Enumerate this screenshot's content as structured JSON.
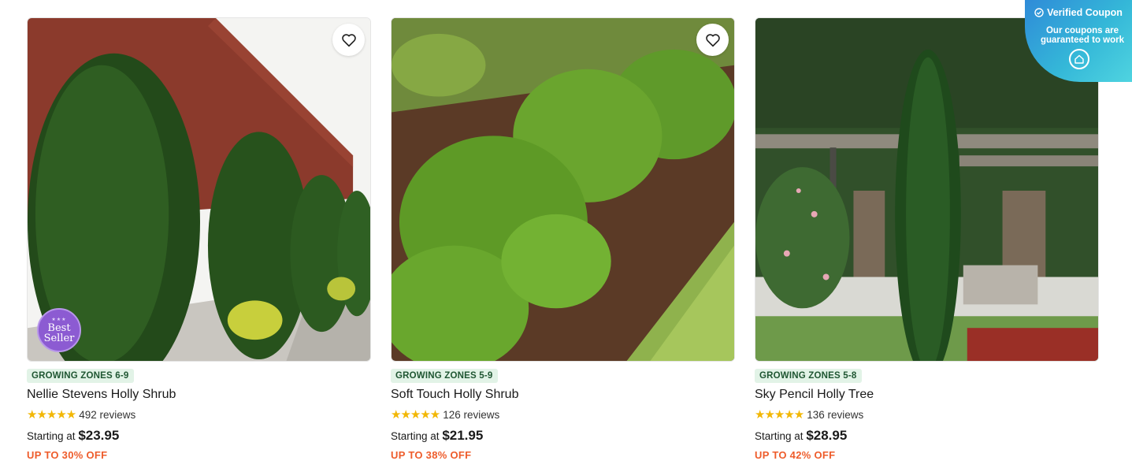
{
  "products": [
    {
      "zones": "GROWING ZONES 6-9",
      "name": "Nellie Stevens Holly Shrub",
      "rating_stars": "★★★★★",
      "reviews": "492 reviews",
      "price_prefix": "Starting at",
      "price": "$23.95",
      "discount": "UP TO 30% OFF",
      "badge_line1": "Best",
      "badge_line2": "Seller"
    },
    {
      "zones": "GROWING ZONES 5-9",
      "name": "Soft Touch Holly Shrub",
      "rating_stars": "★★★★★",
      "reviews": "126 reviews",
      "price_prefix": "Starting at",
      "price": "$21.95",
      "discount": "UP TO 38% OFF"
    },
    {
      "zones": "GROWING ZONES 5-8",
      "name": "Sky Pencil Holly Tree",
      "rating_stars": "★★★★★",
      "reviews": "136 reviews",
      "price_prefix": "Starting at",
      "price": "$28.95",
      "discount": "UP TO 42% OFF"
    }
  ],
  "coupon": {
    "title": "Verified Coupon",
    "text": "Our coupons are guaranteed to work"
  },
  "colors": {
    "accent_discount": "#ee5c2b",
    "zone_bg": "#e2f3e7",
    "zone_text": "#1f5632",
    "star": "#f2b705"
  }
}
